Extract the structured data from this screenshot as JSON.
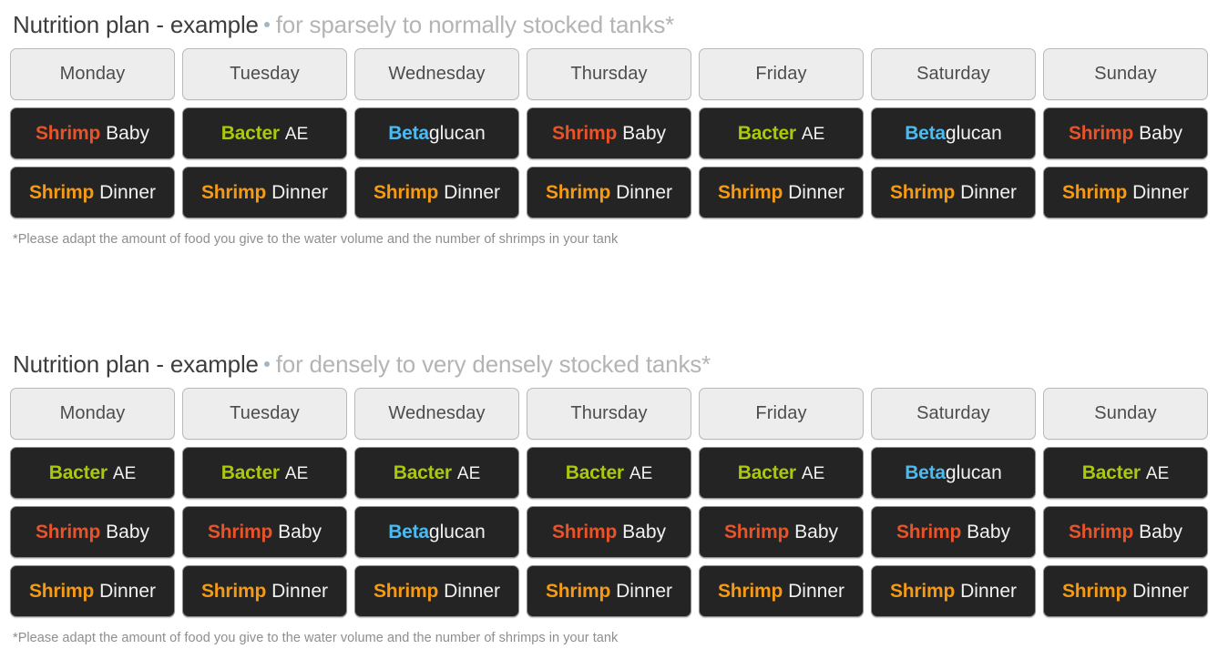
{
  "colors": {
    "shrimp_baby": "#e8532a",
    "shrimp_dinner": "#f59a14",
    "bacter_ae": "#acc80c",
    "betaglucan": "#4cbbf2",
    "variant_text": "#f2f2f2",
    "cell_background": "#242424",
    "header_background": "#ededed",
    "title_main": "#3d3d3d",
    "title_sub": "#b4b4b4",
    "footnote": "#8e8e8e"
  },
  "products": {
    "shrimp_baby": {
      "brand": "Shrimp",
      "variant": "Baby",
      "color": "#e8532a",
      "attached": false,
      "small_variant": false
    },
    "shrimp_dinner": {
      "brand": "Shrimp",
      "variant": "Dinner",
      "color": "#f59a14",
      "attached": false,
      "small_variant": false
    },
    "bacter_ae": {
      "brand": "Bacter",
      "variant": "AE",
      "color": "#acc80c",
      "attached": false,
      "small_variant": true
    },
    "betaglucan": {
      "brand": "Beta",
      "variant": "glucan",
      "color": "#4cbbf2",
      "attached": true,
      "small_variant": false
    }
  },
  "days": [
    "Monday",
    "Tuesday",
    "Wednesday",
    "Thursday",
    "Friday",
    "Saturday",
    "Sunday"
  ],
  "plans": [
    {
      "title_main": "Nutrition plan - example",
      "title_sub": "for sparsely to normally stocked tanks*",
      "days": [
        "Monday",
        "Tuesday",
        "Wednesday",
        "Thursday",
        "Friday",
        "Saturday",
        "Sunday"
      ],
      "rows": [
        [
          "shrimp_baby",
          "bacter_ae",
          "betaglucan",
          "shrimp_baby",
          "bacter_ae",
          "betaglucan",
          "shrimp_baby"
        ],
        [
          "shrimp_dinner",
          "shrimp_dinner",
          "shrimp_dinner",
          "shrimp_dinner",
          "shrimp_dinner",
          "shrimp_dinner",
          "shrimp_dinner"
        ]
      ],
      "footnote": "*Please adapt the amount of food you give to the water volume and the number of shrimps in your tank"
    },
    {
      "title_main": "Nutrition plan - example",
      "title_sub": "for densely to very densely stocked tanks*",
      "days": [
        "Monday",
        "Tuesday",
        "Wednesday",
        "Thursday",
        "Friday",
        "Saturday",
        "Sunday"
      ],
      "rows": [
        [
          "bacter_ae",
          "bacter_ae",
          "bacter_ae",
          "bacter_ae",
          "bacter_ae",
          "betaglucan",
          "bacter_ae"
        ],
        [
          "shrimp_baby",
          "shrimp_baby",
          "betaglucan",
          "shrimp_baby",
          "shrimp_baby",
          "shrimp_baby",
          "shrimp_baby"
        ],
        [
          "shrimp_dinner",
          "shrimp_dinner",
          "shrimp_dinner",
          "shrimp_dinner",
          "shrimp_dinner",
          "shrimp_dinner",
          "shrimp_dinner"
        ]
      ],
      "footnote": "*Please adapt the amount of food you give to the water volume and the number of shrimps in your tank"
    }
  ]
}
